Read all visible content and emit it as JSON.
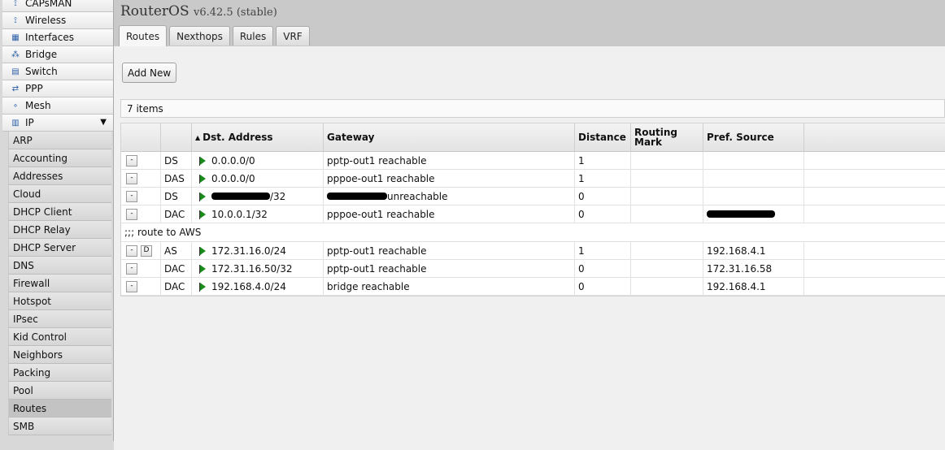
{
  "sidebar": {
    "items": [
      {
        "label": "CAPsMAN",
        "icon": "capsman-icon",
        "glyph": "⟟"
      },
      {
        "label": "Wireless",
        "icon": "wireless-icon",
        "glyph": "⟟"
      },
      {
        "label": "Interfaces",
        "icon": "interfaces-icon",
        "glyph": "▦"
      },
      {
        "label": "Bridge",
        "icon": "bridge-icon",
        "glyph": "⁂"
      },
      {
        "label": "Switch",
        "icon": "switch-icon",
        "glyph": "▤"
      },
      {
        "label": "PPP",
        "icon": "ppp-icon",
        "glyph": "⇄"
      },
      {
        "label": "Mesh",
        "icon": "mesh-icon",
        "glyph": "∘"
      },
      {
        "label": "IP",
        "icon": "ip-icon",
        "glyph": "▥"
      }
    ],
    "ip_arrow": "▼",
    "sub_items": [
      "ARP",
      "Accounting",
      "Addresses",
      "Cloud",
      "DHCP Client",
      "DHCP Relay",
      "DHCP Server",
      "DNS",
      "Firewall",
      "Hotspot",
      "IPsec",
      "Kid Control",
      "Neighbors",
      "Packing",
      "Pool",
      "Routes",
      "SMB"
    ]
  },
  "header": {
    "title": "RouterOS",
    "version": "v6.42.5 (stable)",
    "tabs": [
      "Routes",
      "Nexthops",
      "Rules",
      "VRF"
    ]
  },
  "toolbar": {
    "add_new": "Add New"
  },
  "table": {
    "count": "7 items",
    "sort_arrow": "▲",
    "columns": [
      "",
      "",
      "Dst. Address",
      "Gateway",
      "Distance",
      "Routing Mark",
      "Pref. Source",
      ""
    ],
    "comment": ";;; route to AWS",
    "rows": [
      {
        "btn": "-",
        "btn2": "",
        "flags": "DS",
        "dst": "0.0.0.0/0",
        "gateway": "pptp-out1 reachable",
        "distance": "1",
        "mark": "",
        "pref": ""
      },
      {
        "btn": "-",
        "btn2": "",
        "flags": "DAS",
        "dst": "0.0.0.0/0",
        "gateway": "pppoe-out1 reachable",
        "distance": "1",
        "mark": "",
        "pref": ""
      },
      {
        "btn": "-",
        "btn2": "",
        "flags": "DS",
        "dst": "/32",
        "gateway": "unreachable",
        "distance": "0",
        "mark": "",
        "pref": ""
      },
      {
        "btn": "-",
        "btn2": "",
        "flags": "DAC",
        "dst": "10.0.0.1/32",
        "gateway": "pppoe-out1 reachable",
        "distance": "0",
        "mark": "",
        "pref": ""
      },
      {
        "btn": "-",
        "btn2": "D",
        "flags": "AS",
        "dst": "172.31.16.0/24",
        "gateway": "pptp-out1 reachable",
        "distance": "1",
        "mark": "",
        "pref": "192.168.4.1"
      },
      {
        "btn": "-",
        "btn2": "",
        "flags": "DAC",
        "dst": "172.31.16.50/32",
        "gateway": "pptp-out1 reachable",
        "distance": "0",
        "mark": "",
        "pref": "172.31.16.58"
      },
      {
        "btn": "-",
        "btn2": "",
        "flags": "DAC",
        "dst": "192.168.4.0/24",
        "gateway": "bridge reachable",
        "distance": "0",
        "mark": "",
        "pref": "192.168.4.1"
      }
    ]
  }
}
